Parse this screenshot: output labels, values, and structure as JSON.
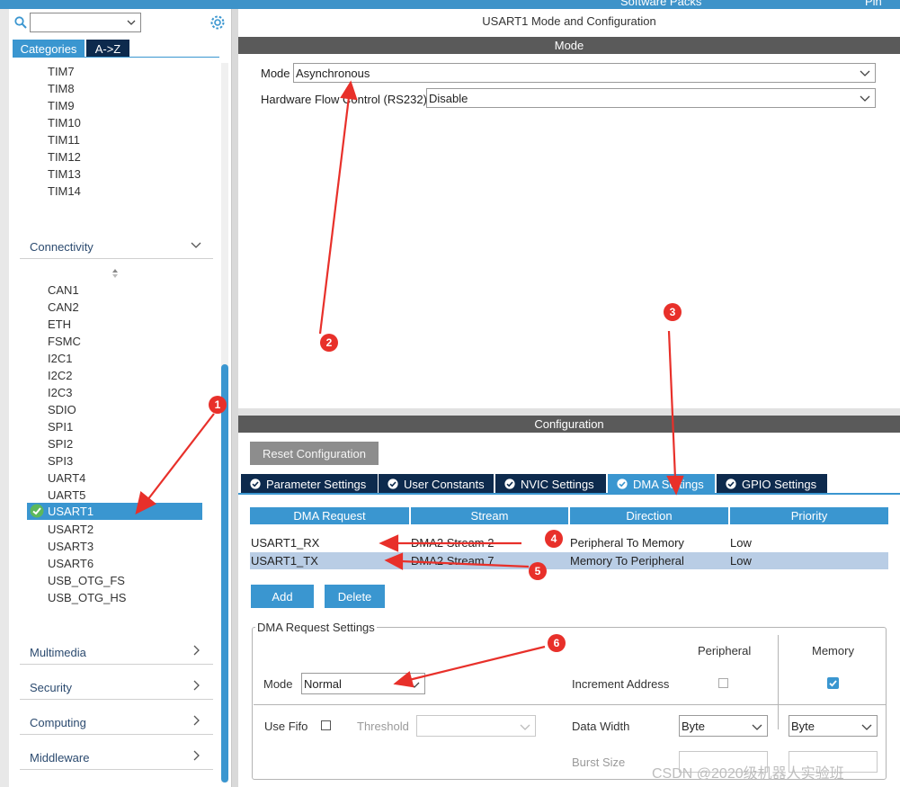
{
  "top_tabs": [
    "Software Packs",
    "Pin"
  ],
  "left": {
    "tabs": [
      "Categories",
      "A->Z"
    ],
    "tim_items": [
      "TIM7",
      "TIM8",
      "TIM9",
      "TIM10",
      "TIM11",
      "TIM12",
      "TIM13",
      "TIM14"
    ],
    "connectivity_label": "Connectivity",
    "conn_items_before": [
      "CAN1",
      "CAN2",
      "ETH",
      "FSMC",
      "I2C1",
      "I2C2",
      "I2C3",
      "SDIO",
      "SPI1",
      "SPI2",
      "SPI3",
      "UART4",
      "UART5"
    ],
    "selected": "USART1",
    "conn_items_after": [
      "USART2",
      "USART3",
      "USART6",
      "USB_OTG_FS",
      "USB_OTG_HS"
    ],
    "categories": [
      "Multimedia",
      "Security",
      "Computing",
      "Middleware"
    ]
  },
  "right": {
    "title": "USART1 Mode and Configuration",
    "mode_header": "Mode",
    "mode_label": "Mode",
    "mode_value": "Asynchronous",
    "flow_label": "Hardware Flow Control (RS232)",
    "flow_value": "Disable",
    "config_header": "Configuration",
    "reset_label": "Reset Configuration",
    "tabs": [
      "Parameter Settings",
      "User Constants",
      "NVIC Settings",
      "DMA Settings",
      "GPIO Settings"
    ],
    "active_tab": "DMA Settings",
    "dma_table": {
      "headers": [
        "DMA Request",
        "Stream",
        "Direction",
        "Priority"
      ],
      "rows": [
        [
          "USART1_RX",
          "DMA2 Stream 2",
          "Peripheral To Memory",
          "Low"
        ],
        [
          "USART1_TX",
          "DMA2 Stream 7",
          "Memory To Peripheral",
          "Low"
        ]
      ]
    },
    "add_label": "Add",
    "delete_label": "Delete",
    "req_settings": {
      "legend": "DMA Request Settings",
      "peripheral_header": "Peripheral",
      "memory_header": "Memory",
      "mode_label": "Mode",
      "mode_value": "Normal",
      "increment_label": "Increment Address",
      "use_fifo_label": "Use Fifo",
      "threshold_label": "Threshold",
      "data_width_label": "Data Width",
      "periph_width": "Byte",
      "mem_width": "Byte",
      "burst_label": "Burst Size"
    }
  },
  "annotations": [
    "1",
    "2",
    "3",
    "4",
    "5",
    "6"
  ],
  "watermark": "CSDN @2020级机器人实验班",
  "colors": {
    "accent": "#3a96d0",
    "dark_tab": "#0d2a4d",
    "header_grey": "#5a5a5a",
    "annotation_red": "#e8302a"
  }
}
